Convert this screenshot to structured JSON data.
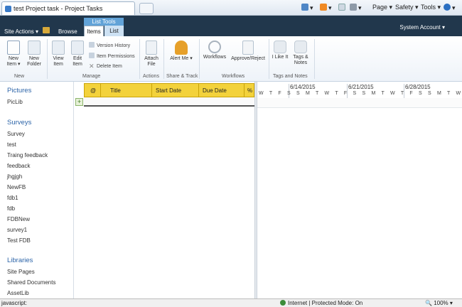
{
  "browser": {
    "tab_title": "test Project task - Project Tasks",
    "commands": {
      "page": "Page ▾",
      "safety": "Safety ▾",
      "tools": "Tools ▾"
    }
  },
  "sp": {
    "site_actions": "Site Actions ▾",
    "browse_tab": "Browse",
    "list_tools_label": "List Tools",
    "items_tab": "Items",
    "list_tab": "List",
    "user": "System Account ▾"
  },
  "ribbon": {
    "new_item": "New Item ▾",
    "new_folder": "New Folder",
    "view_item": "View Item",
    "edit_item": "Edit Item",
    "version_history": "Version History",
    "item_permissions": "Item Permissions",
    "delete_item": "Delete Item",
    "attach_file": "Attach File",
    "alert_me": "Alert Me ▾",
    "workflows": "Workflows",
    "approve_reject": "Approve/Reject",
    "i_like_it": "I Like It",
    "tags_notes": "Tags & Notes",
    "groups": {
      "new": "New",
      "manage": "Manage",
      "actions": "Actions",
      "share_track": "Share & Track",
      "workflows": "Workflows",
      "tags_notes": "Tags and Notes"
    }
  },
  "nav": {
    "pictures_header": "Pictures",
    "pictures": [
      "PicLib"
    ],
    "surveys_header": "Surveys",
    "surveys": [
      "Survey",
      "test",
      "Traing feedback",
      "feedback",
      "jhgjgh",
      "NewFB",
      "fdb1",
      "fdb",
      "FDBNew",
      "survey1",
      "Test FDB"
    ],
    "libraries_header": "Libraries",
    "libraries": [
      "Site Pages",
      "Shared Documents",
      "AssetLib"
    ]
  },
  "grid": {
    "columns": [
      "Title",
      "Start Date",
      "Due Date",
      "%"
    ],
    "add_symbol": "+"
  },
  "gantt": {
    "weeks": [
      "6/14/2015",
      "6/21/2015",
      "6/28/2015"
    ],
    "day_letters": "W T F S S M T W T F S S M T W T F S S M T W T F S S M T W T F"
  },
  "status": {
    "left": "javascript:",
    "zone": "Internet | Protected Mode: On",
    "zoom": "100%"
  },
  "colors": {
    "accent_dark": "#21374c",
    "list_tools": "#62a3d8",
    "header_yellow": "#f3d23b",
    "nav_link": "#2c64a8"
  }
}
